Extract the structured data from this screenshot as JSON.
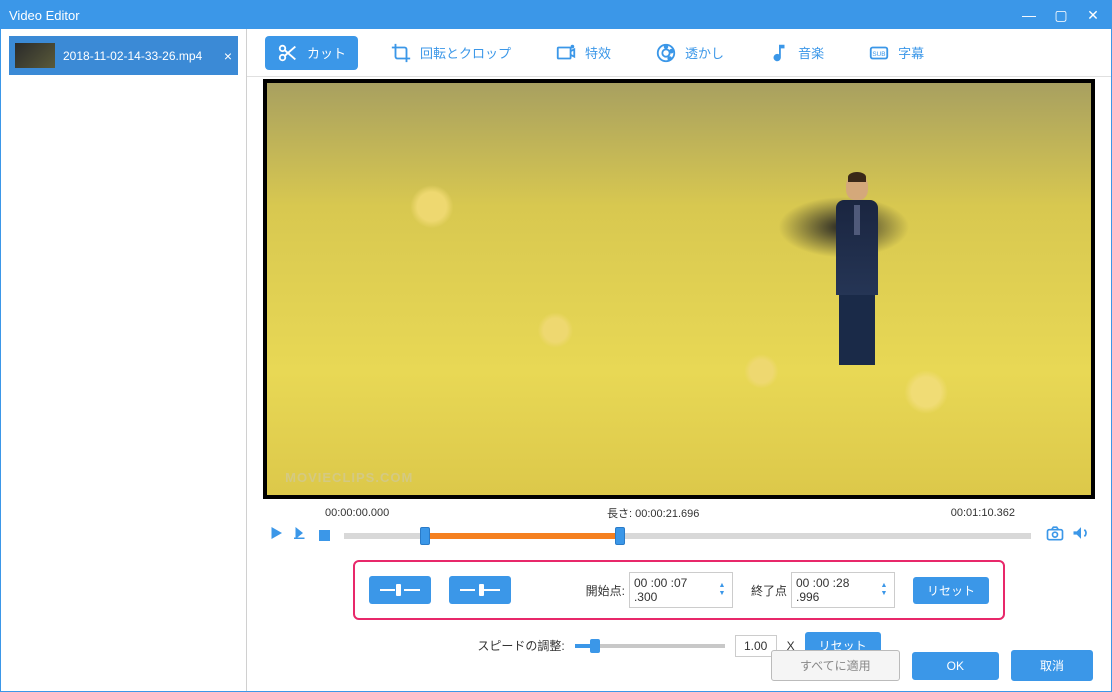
{
  "app": {
    "title": "Video Editor"
  },
  "window_controls": {
    "minimize": "—",
    "maximize": "▢",
    "close": "✕"
  },
  "sidebar": {
    "file_name": "2018-11-02-14-33-26.mp4"
  },
  "toolbar": {
    "tabs": [
      {
        "label": "カット"
      },
      {
        "label": "回転とクロップ"
      },
      {
        "label": "特效"
      },
      {
        "label": "透かし"
      },
      {
        "label": "音楽"
      },
      {
        "label": "字幕"
      }
    ]
  },
  "preview": {
    "watermark": "MOVIECLIPS.COM"
  },
  "timeline": {
    "start_time": "00:00:00.000",
    "length_label": "長さ:",
    "length_value": "00:00:21.696",
    "end_time": "00:01:10.362"
  },
  "cut_panel": {
    "start_label": "開始点:",
    "start_value": "00 :00 :07 .300",
    "end_label": "終了点",
    "end_value": "00 :00 :28 .996",
    "reset_label": "リセット"
  },
  "speed": {
    "label": "スピードの調整:",
    "value": "1.00",
    "unit": "X",
    "reset_label": "リセット"
  },
  "footer": {
    "apply_all": "すべてに適用",
    "ok": "OK",
    "cancel": "取消"
  }
}
